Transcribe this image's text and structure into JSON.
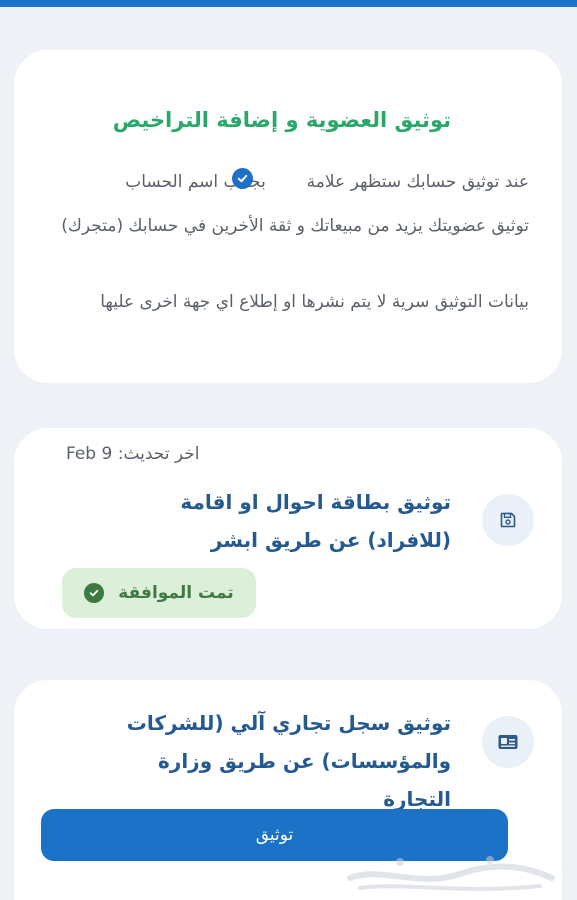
{
  "info_card": {
    "title": "توثيق العضوية و إضافة التراخيص",
    "line1_before": "عند توثيق حسابك ستظهر علامة",
    "line1_after": "بجانب اسم الحساب",
    "line2": "توثيق عضويتك يزيد من مبيعاتك و ثقة الأخرين في حسابك (متجرك)",
    "line3": "بيانات التوثيق سرية لا يتم نشرها او إطلاع اي جهة اخرى عليها"
  },
  "id_card": {
    "updated_label": "اخر تحديث:",
    "updated_value": "Feb 9",
    "title": "توثيق بطاقة احوال او اقامة (للافراد) عن طريق ابشر",
    "icon": "save-icon",
    "status": "تمت الموافقة",
    "status_color": "#dcefd9"
  },
  "cr_card": {
    "title": "توثيق سجل تجاري آلي (للشركات والمؤسسات) عن طريق وزارة التجارة",
    "icon": "id-card-icon",
    "button_label": "توثيق"
  },
  "watermark": {
    "text": "حراج"
  },
  "colors": {
    "accent": "#1c72c6",
    "success_text": "#2aa86a",
    "title_blue": "#255a91"
  }
}
